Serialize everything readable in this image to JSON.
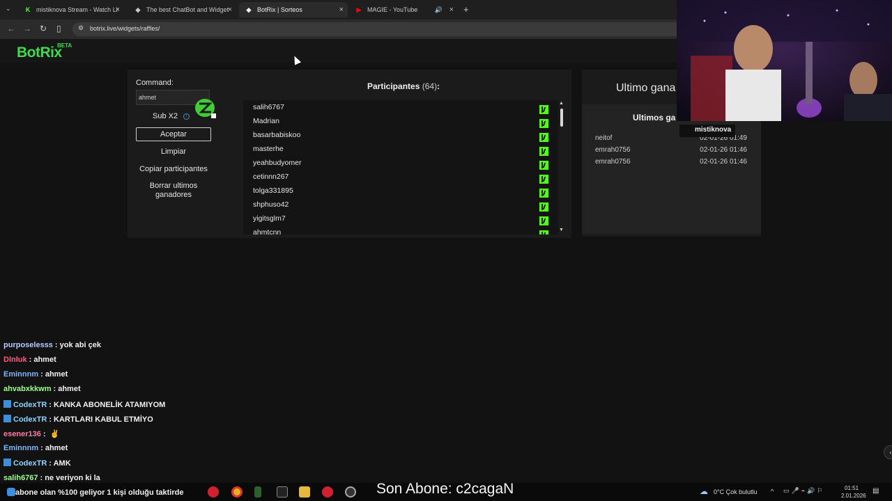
{
  "tabs": [
    {
      "title": "mistiknova Stream - Watch Live",
      "icon": "kick-icon",
      "color": "#53fc18"
    },
    {
      "title": "The best ChatBot and Widgets",
      "icon": "botrix-icon",
      "color": "#ffffff"
    },
    {
      "title": "BotRix | Sorteos",
      "icon": "botrix-icon",
      "color": "#ffffff"
    },
    {
      "title": "MAGIE - YouTube",
      "icon": "youtube-icon",
      "color": "#ff0000"
    }
  ],
  "url": "botrix.live/widgets/raffles/",
  "brand": {
    "logo": "BotRix",
    "beta": "BETA",
    "accent": "#3ddc4a"
  },
  "raffle": {
    "command_label": "Command:",
    "command_value": "ahmet",
    "sub_label": "Sub X2",
    "buttons": {
      "accept": "Aceptar",
      "clear": "Limpiar",
      "copy": "Copiar participantes",
      "delete_winners": "Borrar ultimos ganadores"
    },
    "participants_title": "Participantes",
    "participants_count": "(64)",
    "participants_colon": ":",
    "participants": [
      "salih6767",
      "Madrian",
      "basarbabiskoo",
      "masterhe",
      "yeahbudyomer",
      "cetinnn267",
      "tolga331895",
      "shphuso42",
      "yigitsglm7",
      "ahmtcnn"
    ],
    "last_winner_title": "Ultimo gana",
    "last_winners_title": "Ultimos ga",
    "winners": [
      {
        "name": "neitof",
        "date": "02-01-26 01:49"
      },
      {
        "name": "emrah0756",
        "date": "02-01-26 01:46"
      },
      {
        "name": "emrah0756",
        "date": "02-01-26 01:46"
      }
    ]
  },
  "stream": {
    "channel_name": "mistiknova"
  },
  "chat": [
    {
      "user": "purposelesss",
      "color": "#b9c9ff",
      "msg": ": yok abi çek",
      "badge": false
    },
    {
      "user": "Dlnluk",
      "color": "#ff5a7a",
      "msg": ": ahmet",
      "badge": false
    },
    {
      "user": "Eminnnm",
      "color": "#7fb6ff",
      "msg": ": ahmet",
      "badge": false
    },
    {
      "user": "ahvabxkkwm",
      "color": "#9dff8a",
      "msg": ": ahmet",
      "badge": false
    },
    {
      "user": "CodexTR",
      "color": "#8fd3ff",
      "msg": ": KANKA ABONELİK ATAMIYOM",
      "badge": true
    },
    {
      "user": "CodexTR",
      "color": "#8fd3ff",
      "msg": ": KARTLARI KABUL ETMİYO",
      "badge": true
    },
    {
      "user": "esener136",
      "color": "#ff7aa8",
      "msg": ":",
      "badge": false
    },
    {
      "user": "Eminnnm",
      "color": "#7fb6ff",
      "msg": ": ahmet",
      "badge": false
    },
    {
      "user": "CodexTR",
      "color": "#8fd3ff",
      "msg": ": AMK",
      "badge": true
    },
    {
      "user": "salih6767",
      "color": "#9dff8a",
      "msg": ": ne veriyon ki la",
      "badge": false
    }
  ],
  "overlay": {
    "ticker": "abone olan %100 geliyor 1 kişi olduğu taktirde",
    "last_sub": "Son Abone: c2cagaN"
  },
  "taskbar": {
    "weather": "0°C  Çok bulutlu",
    "time": "01:51",
    "date": "2.01.2026"
  }
}
